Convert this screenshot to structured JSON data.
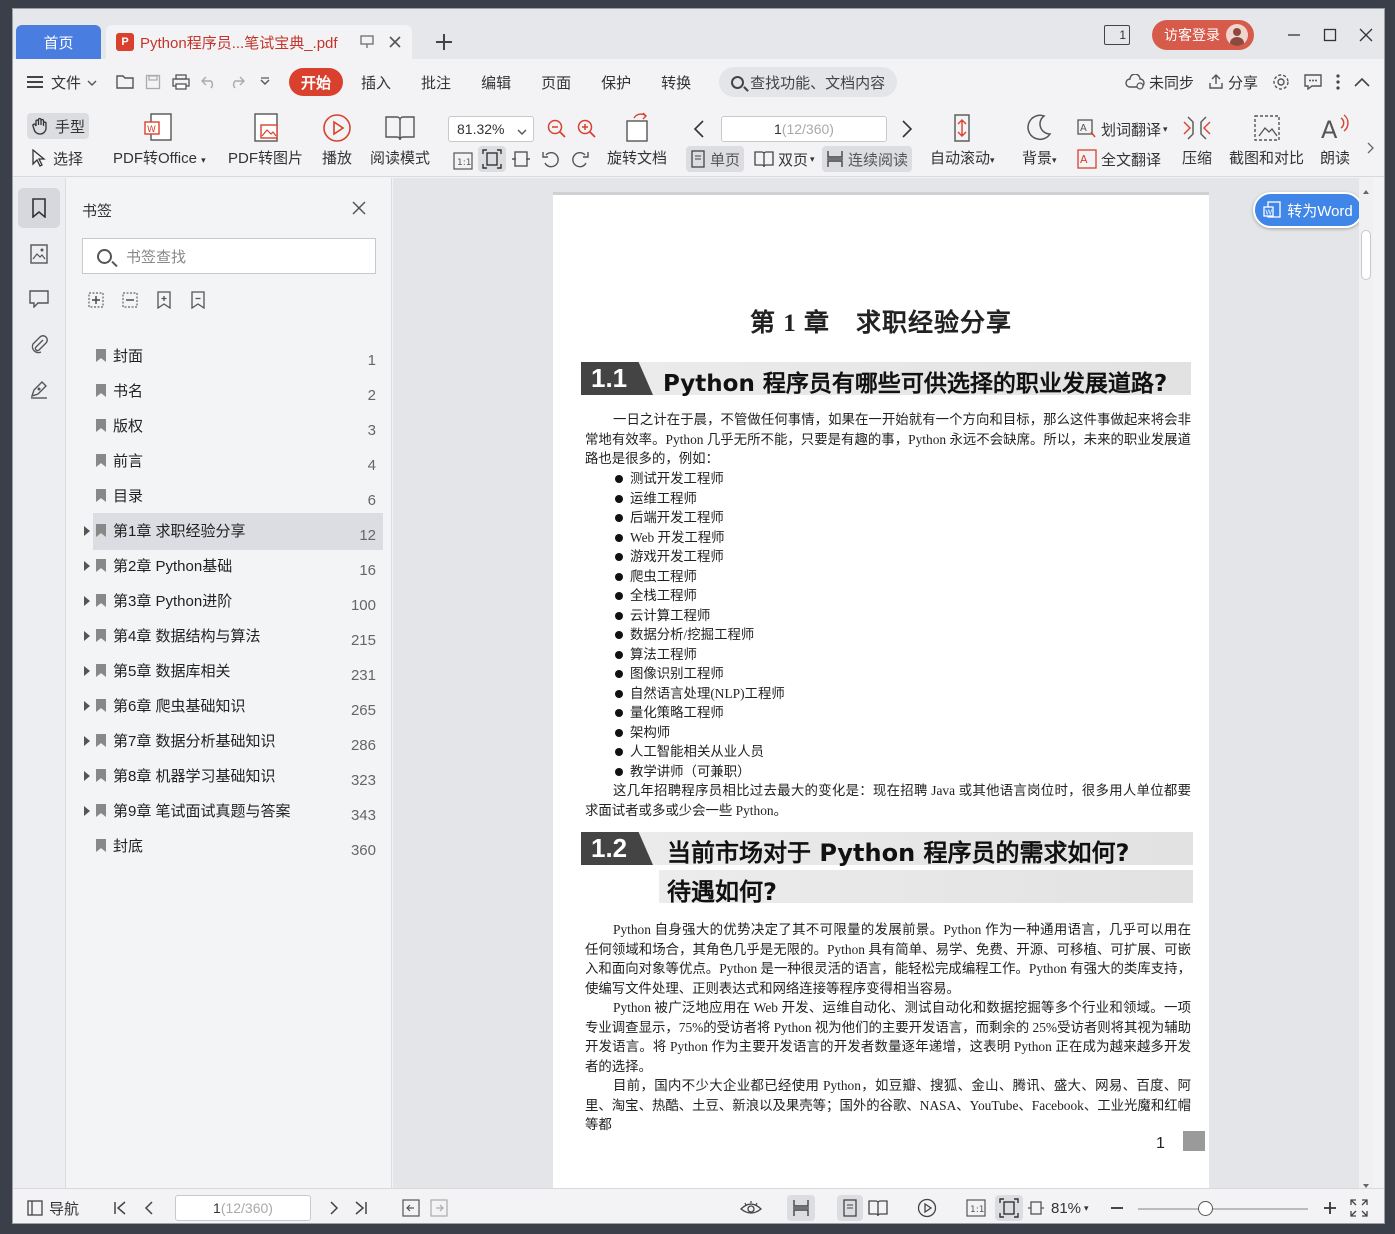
{
  "titlebar": {
    "home_tab": "首页",
    "doc_tab": "Python程序员...笔试宝典_.pdf",
    "pdf_badge": "P",
    "window_count": "1",
    "login": "访客登录"
  },
  "menubar": {
    "file": "文件",
    "tabs": [
      "开始",
      "插入",
      "批注",
      "编辑",
      "页面",
      "保护",
      "转换"
    ],
    "search": "查找功能、文档内容",
    "unsynced": "未同步",
    "share": "分享"
  },
  "ribbon": {
    "hand": "手型",
    "select": "选择",
    "pdf_to_office": "PDF转Office",
    "pdf_to_image": "PDF转图片",
    "play": "播放",
    "read_mode": "阅读模式",
    "zoom": "81.32%",
    "rotate": "旋转文档",
    "page_current": "1",
    "page_total": " (12/360)",
    "single": "单页",
    "double": "双页",
    "continuous": "连续阅读",
    "autoscroll": "自动滚动",
    "background": "背景",
    "word_translate": "划词翻译",
    "full_translate": "全文翻译",
    "compress": "压缩",
    "screenshot_compare": "截图和对比",
    "read_aloud": "朗读"
  },
  "bookmarks": {
    "title": "书签",
    "search_placeholder": "书签查找",
    "items": [
      {
        "name": "封面",
        "page": "1",
        "expandable": false
      },
      {
        "name": "书名",
        "page": "2",
        "expandable": false
      },
      {
        "name": "版权",
        "page": "3",
        "expandable": false
      },
      {
        "name": "前言",
        "page": "4",
        "expandable": false
      },
      {
        "name": "目录",
        "page": "6",
        "expandable": false
      },
      {
        "name": "第1章 求职经验分享",
        "page": "12",
        "expandable": true,
        "selected": true
      },
      {
        "name": "第2章 Python基础",
        "page": "16",
        "expandable": true
      },
      {
        "name": "第3章 Python进阶",
        "page": "100",
        "expandable": true
      },
      {
        "name": "第4章 数据结构与算法",
        "page": "215",
        "expandable": true
      },
      {
        "name": "第5章 数据库相关",
        "page": "231",
        "expandable": true
      },
      {
        "name": "第6章 爬虫基础知识",
        "page": "265",
        "expandable": true
      },
      {
        "name": "第7章 数据分析基础知识",
        "page": "286",
        "expandable": true
      },
      {
        "name": "第8章 机器学习基础知识",
        "page": "323",
        "expandable": true
      },
      {
        "name": "第9章 笔试面试真题与答案",
        "page": "343",
        "expandable": true
      },
      {
        "name": "封底",
        "page": "360",
        "expandable": false
      }
    ]
  },
  "document": {
    "to_word": "转为Word",
    "chapter_title": "第 1 章　求职经验分享",
    "sec1_num": "1.1",
    "sec1_title": "Python 程序员有哪些可供选择的职业发展道路?",
    "sec1_para1": "一日之计在于晨，不管做任何事情，如果在一开始就有一个方向和目标，那么这件事做起来将会非常地有效率。Python 几乎无所不能，只要是有趣的事，Python 永远不会缺席。所以，未来的职业发展道路也是很多的，例如：",
    "jobs": [
      "测试开发工程师",
      "运维工程师",
      "后端开发工程师",
      "Web 开发工程师",
      "游戏开发工程师",
      "爬虫工程师",
      "全栈工程师",
      "云计算工程师",
      "数据分析/挖掘工程师",
      "算法工程师",
      "图像识别工程师",
      "自然语言处理(NLP)工程师",
      "量化策略工程师",
      "架构师",
      "人工智能相关从业人员",
      "教学讲师（可兼职）"
    ],
    "sec1_para2": "这几年招聘程序员相比过去最大的变化是：现在招聘 Java 或其他语言岗位时，很多用人单位都要求面试者或多或少会一些 Python。",
    "sec2_num": "1.2",
    "sec2_title_line1": "当前市场对于 Python 程序员的需求如何?",
    "sec2_title_line2": "待遇如何?",
    "sec2_para1": "Python 自身强大的优势决定了其不可限量的发展前景。Python 作为一种通用语言，几乎可以用在任何领域和场合，其角色几乎是无限的。Python 具有简单、易学、免费、开源、可移植、可扩展、可嵌入和面向对象等优点。Python 是一种很灵活的语言，能轻松完成编程工作。Python 有强大的类库支持，使编写文件处理、正则表达式和网络连接等程序变得相当容易。",
    "sec2_para2": "Python 被广泛地应用在 Web 开发、运维自动化、测试自动化和数据挖掘等多个行业和领域。一项专业调查显示，75%的受访者将 Python 视为他们的主要开发语言，而剩余的 25%受访者则将其视为辅助开发语言。将 Python 作为主要开发语言的开发者数量逐年递增，这表明 Python 正在成为越来越多开发者的选择。",
    "sec2_para3": "目前，国内不少大企业都已经使用 Python，如豆瓣、搜狐、金山、腾讯、盛大、网易、百度、阿里、淘宝、热酷、土豆、新浪以及果壳等；国外的谷歌、NASA、YouTube、Facebook、工业光魔和红帽等都",
    "page_number": "1"
  },
  "statusbar": {
    "nav": "导航",
    "page_current": "1",
    "page_total": " (12/360)",
    "zoom": "81%"
  }
}
